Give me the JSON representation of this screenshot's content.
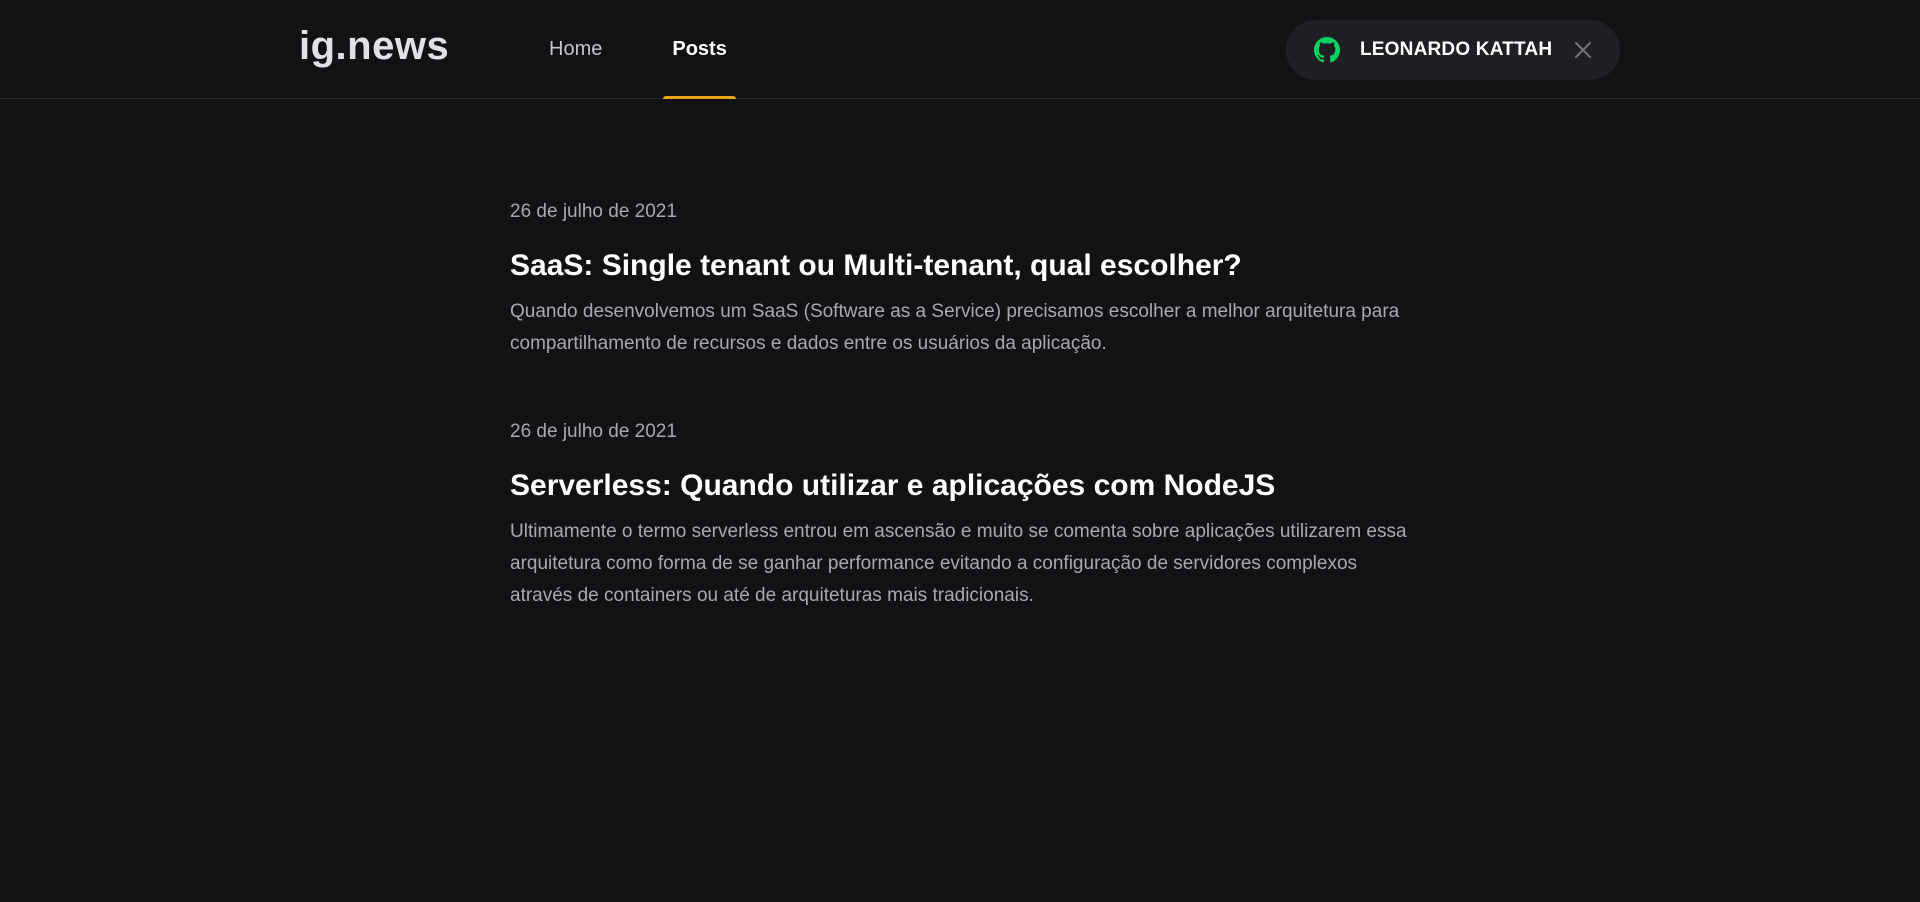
{
  "header": {
    "logo": "ig.news",
    "nav": [
      {
        "label": "Home",
        "active": false
      },
      {
        "label": "Posts",
        "active": true
      }
    ],
    "user": {
      "name": "LEONARDO KATTAH",
      "icon": "github-icon",
      "close_icon": "close-icon"
    }
  },
  "colors": {
    "background": "#121214",
    "accent": "#eba417",
    "github_green": "#04d361"
  },
  "posts": [
    {
      "date": "26 de julho de 2021",
      "title": "SaaS: Single tenant ou Multi-tenant, qual escolher?",
      "excerpt": "Quando desenvolvemos um SaaS (Software as a Service) precisamos escolher a melhor arquitetura para compartilhamento de recursos e dados entre os usuários da aplicação."
    },
    {
      "date": "26 de julho de 2021",
      "title": "Serverless: Quando utilizar e aplicações com NodeJS",
      "excerpt": "Ultimamente o termo serverless entrou em ascensão e muito se comenta sobre aplicações utilizarem essa arquitetura como forma de se ganhar performance evitando a configuração de servidores complexos através de containers ou até de arquiteturas mais tradicionais."
    }
  ]
}
